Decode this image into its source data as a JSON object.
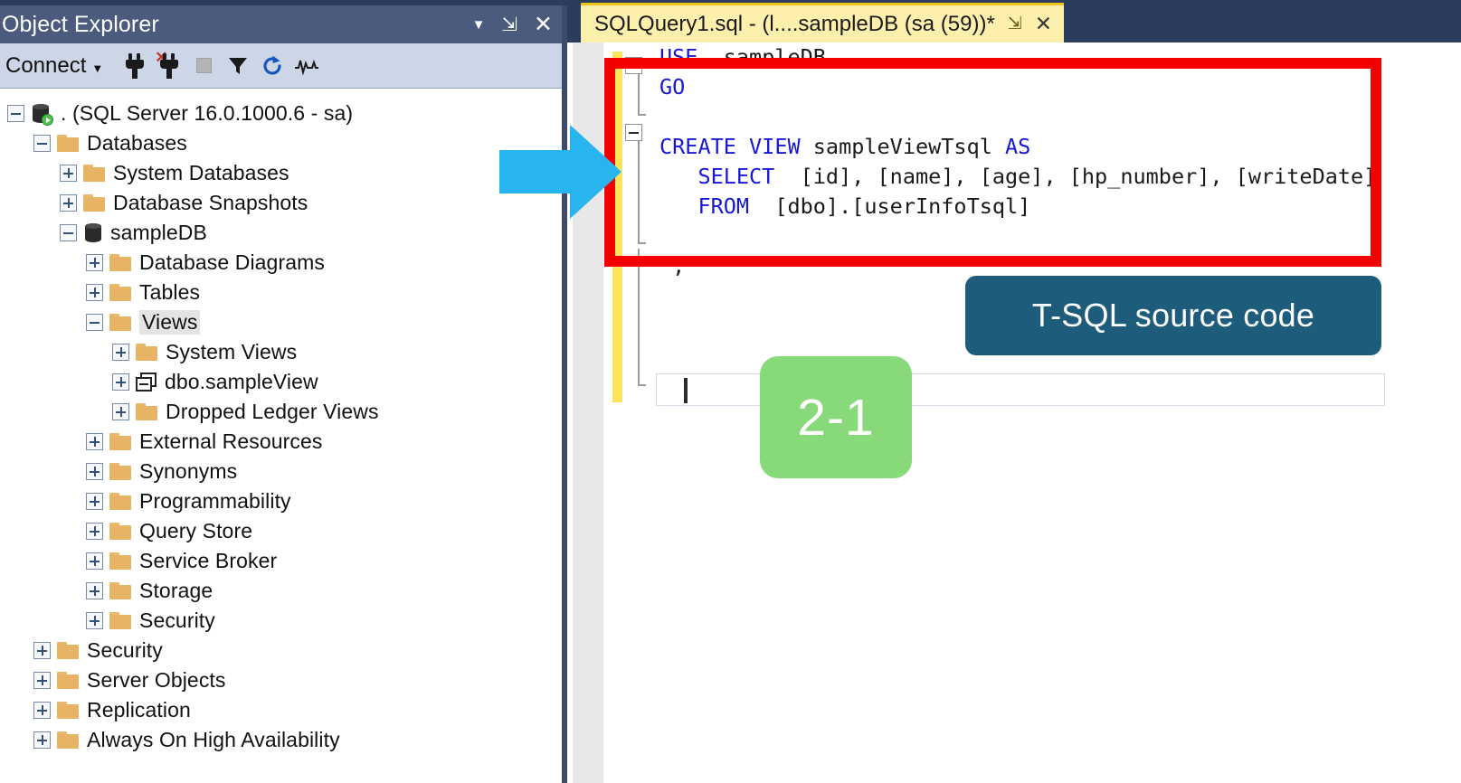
{
  "window": {
    "accent_dark": "#2b3c5c",
    "panel_header": "#4a5b7d",
    "toolbar_bg": "#cdd6e6",
    "tab_yellow": "#fdf0ad",
    "highlight_red": "#f50000",
    "callout_blue": "#1d5c7a",
    "badge_green": "#87d979",
    "arrow_blue": "#28b5ef"
  },
  "object_explorer": {
    "title": "Object Explorer",
    "title_buttons": [
      {
        "name": "dropdown",
        "glyph": "▼"
      },
      {
        "name": "pin",
        "glyph": "⇲"
      },
      {
        "name": "close",
        "glyph": "✕"
      }
    ],
    "toolbar": {
      "connect_label": "Connect",
      "connect_caret": "▼",
      "buttons": [
        {
          "name": "connect-icon",
          "tooltip": "Connect"
        },
        {
          "name": "disconnect-icon",
          "tooltip": "Disconnect"
        },
        {
          "name": "stop-icon",
          "tooltip": "Stop"
        },
        {
          "name": "filter-icon",
          "tooltip": "Filter"
        },
        {
          "name": "refresh-icon",
          "tooltip": "Refresh"
        },
        {
          "name": "activity-monitor-icon",
          "tooltip": "Activity Monitor"
        }
      ]
    },
    "tree": [
      {
        "label": ". (SQL Server 16.0.1000.6 - sa)",
        "indent": 0,
        "state": "expanded",
        "icon": "server",
        "selected": false
      },
      {
        "label": "Databases",
        "indent": 1,
        "state": "expanded",
        "icon": "folder",
        "selected": false
      },
      {
        "label": "System Databases",
        "indent": 2,
        "state": "collapsed",
        "icon": "folder",
        "selected": false
      },
      {
        "label": "Database Snapshots",
        "indent": 2,
        "state": "collapsed",
        "icon": "folder",
        "selected": false
      },
      {
        "label": "sampleDB",
        "indent": 2,
        "state": "expanded",
        "icon": "database",
        "selected": false
      },
      {
        "label": "Database Diagrams",
        "indent": 3,
        "state": "collapsed",
        "icon": "folder",
        "selected": false
      },
      {
        "label": "Tables",
        "indent": 3,
        "state": "collapsed",
        "icon": "folder",
        "selected": false
      },
      {
        "label": "Views",
        "indent": 3,
        "state": "expanded",
        "icon": "folder",
        "selected": true
      },
      {
        "label": "System Views",
        "indent": 4,
        "state": "collapsed",
        "icon": "folder",
        "selected": false
      },
      {
        "label": "dbo.sampleView",
        "indent": 4,
        "state": "collapsed",
        "icon": "view",
        "selected": false
      },
      {
        "label": "Dropped Ledger Views",
        "indent": 4,
        "state": "collapsed",
        "icon": "folder",
        "selected": false
      },
      {
        "label": "External Resources",
        "indent": 3,
        "state": "collapsed",
        "icon": "folder",
        "selected": false
      },
      {
        "label": "Synonyms",
        "indent": 3,
        "state": "collapsed",
        "icon": "folder",
        "selected": false
      },
      {
        "label": "Programmability",
        "indent": 3,
        "state": "collapsed",
        "icon": "folder",
        "selected": false
      },
      {
        "label": "Query Store",
        "indent": 3,
        "state": "collapsed",
        "icon": "folder",
        "selected": false
      },
      {
        "label": "Service Broker",
        "indent": 3,
        "state": "collapsed",
        "icon": "folder",
        "selected": false
      },
      {
        "label": "Storage",
        "indent": 3,
        "state": "collapsed",
        "icon": "folder",
        "selected": false
      },
      {
        "label": "Security",
        "indent": 3,
        "state": "collapsed",
        "icon": "folder",
        "selected": false
      },
      {
        "label": "Security",
        "indent": 1,
        "state": "collapsed",
        "icon": "folder",
        "selected": false
      },
      {
        "label": "Server Objects",
        "indent": 1,
        "state": "collapsed",
        "icon": "folder",
        "selected": false
      },
      {
        "label": "Replication",
        "indent": 1,
        "state": "collapsed",
        "icon": "folder",
        "selected": false
      },
      {
        "label": "Always On High Availability",
        "indent": 1,
        "state": "collapsed",
        "icon": "folder",
        "selected": false
      }
    ]
  },
  "editor": {
    "tab": {
      "title": "SQLQuery1.sql - (l....sampleDB (sa (59))*",
      "pin_glyph": "⇲",
      "close_glyph": "✕"
    },
    "code_lines": [
      {
        "fold": "open",
        "tokens": [
          {
            "t": "USE",
            "c": "kw"
          },
          {
            "t": "  sampleDB",
            "c": "id"
          }
        ]
      },
      {
        "fold": "bar",
        "tokens": [
          {
            "t": "GO",
            "c": "kw"
          }
        ]
      },
      {
        "fold": "end",
        "tokens": []
      },
      {
        "fold": "open",
        "tokens": [
          {
            "t": "CREATE VIEW",
            "c": "kw"
          },
          {
            "t": " sampleViewTsql ",
            "c": "id"
          },
          {
            "t": "AS",
            "c": "kw"
          }
        ]
      },
      {
        "fold": "bar",
        "tokens": [
          {
            "t": "   SELECT",
            "c": "kw"
          },
          {
            "t": "  [id], [name], [age], [hp_number], [writeDate]",
            "c": "id"
          }
        ]
      },
      {
        "fold": "bar",
        "tokens": [
          {
            "t": "   FROM",
            "c": "kw"
          },
          {
            "t": "  [dbo].[userInfoTsql]",
            "c": "id"
          }
        ]
      },
      {
        "fold": "tick",
        "tokens": []
      },
      {
        "fold": "bar",
        "tokens": [
          {
            "t": " ;",
            "c": "id"
          }
        ]
      }
    ],
    "code_text": "USE  sampleDB\nGO\nCREATE VIEW sampleViewTsql AS\n   SELECT  [id], [name], [age], [hp_number], [writeDate]\n   FROM  [dbo].[userInfoTsql]\n ;"
  },
  "annotations": {
    "tsql_callout": "T-SQL source code",
    "step_badge": "2-1",
    "arrow": "right-arrow"
  }
}
